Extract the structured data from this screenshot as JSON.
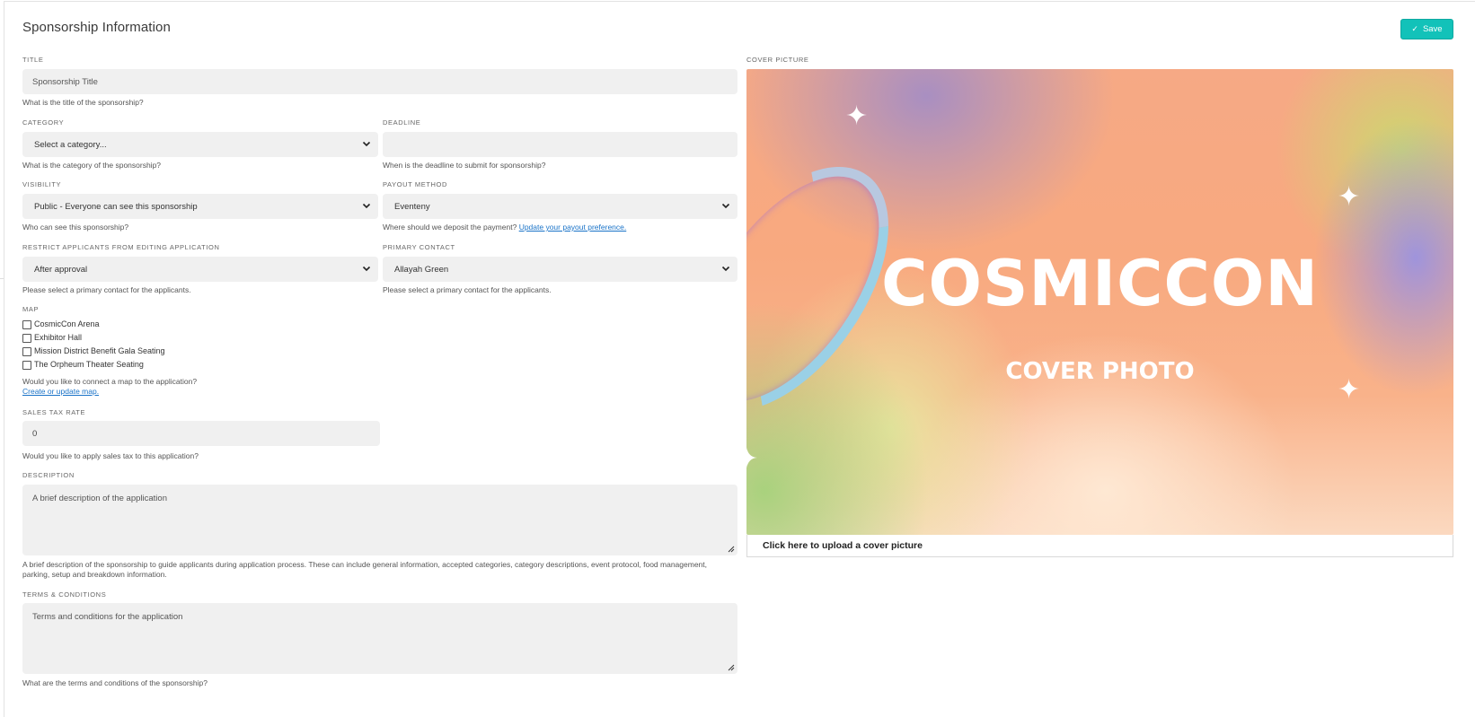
{
  "header": {
    "title": "Sponsorship Information",
    "save_label": "Save"
  },
  "title_field": {
    "label": "TITLE",
    "placeholder": "Sponsorship Title",
    "help": "What is the title of the sponsorship?"
  },
  "category": {
    "label": "CATEGORY",
    "value": "Select a category...",
    "help": "What is the category of the sponsorship?"
  },
  "deadline": {
    "label": "DEADLINE",
    "value": "",
    "help": "When is the deadline to submit for sponsorship?"
  },
  "visibility": {
    "label": "VISIBILITY",
    "value": "Public - Everyone can see this sponsorship",
    "help": "Who can see this sponsorship?"
  },
  "payout": {
    "label": "PAYOUT METHOD",
    "value": "Eventeny",
    "help": "Where should we deposit the payment?",
    "link": "Update your payout preference."
  },
  "restrict": {
    "label": "RESTRICT APPLICANTS FROM EDITING APPLICATION",
    "value": "After approval",
    "help": "Please select a primary contact for the applicants."
  },
  "primary_contact": {
    "label": "PRIMARY CONTACT",
    "value": "Allayah Green",
    "help": "Please select a primary contact for the applicants."
  },
  "map": {
    "label": "MAP",
    "options": [
      "CosmicCon Arena",
      "Exhibitor Hall",
      "Mission District Benefit Gala Seating",
      "The Orpheum Theater Seating"
    ],
    "help": "Would you like to connect a map to the application?",
    "link": "Create or update map."
  },
  "sales_tax": {
    "label": "SALES TAX RATE",
    "value": "0",
    "help": "Would you like to apply sales tax to this application?"
  },
  "description": {
    "label": "DESCRIPTION",
    "placeholder": "A brief description of the application",
    "help_line1": "A brief description of the sponsorship to guide applicants during application process. These can include general information, accepted categories, category descriptions, event protocol, food management,",
    "help_line2": "parking, setup and breakdown information."
  },
  "terms": {
    "label": "TERMS & CONDITIONS",
    "placeholder": "Terms and conditions for the application",
    "help": "What are the terms and conditions of the sponsorship?"
  },
  "cover": {
    "label": "COVER PICTURE",
    "image_title": "COSMICCON",
    "image_subtitle": "COVER PHOTO",
    "upload_label": "Click here to upload a cover picture"
  },
  "colors": {
    "accent": "#12c2b9",
    "link": "#1a73c8",
    "field_bg": "#f0f0f0"
  }
}
